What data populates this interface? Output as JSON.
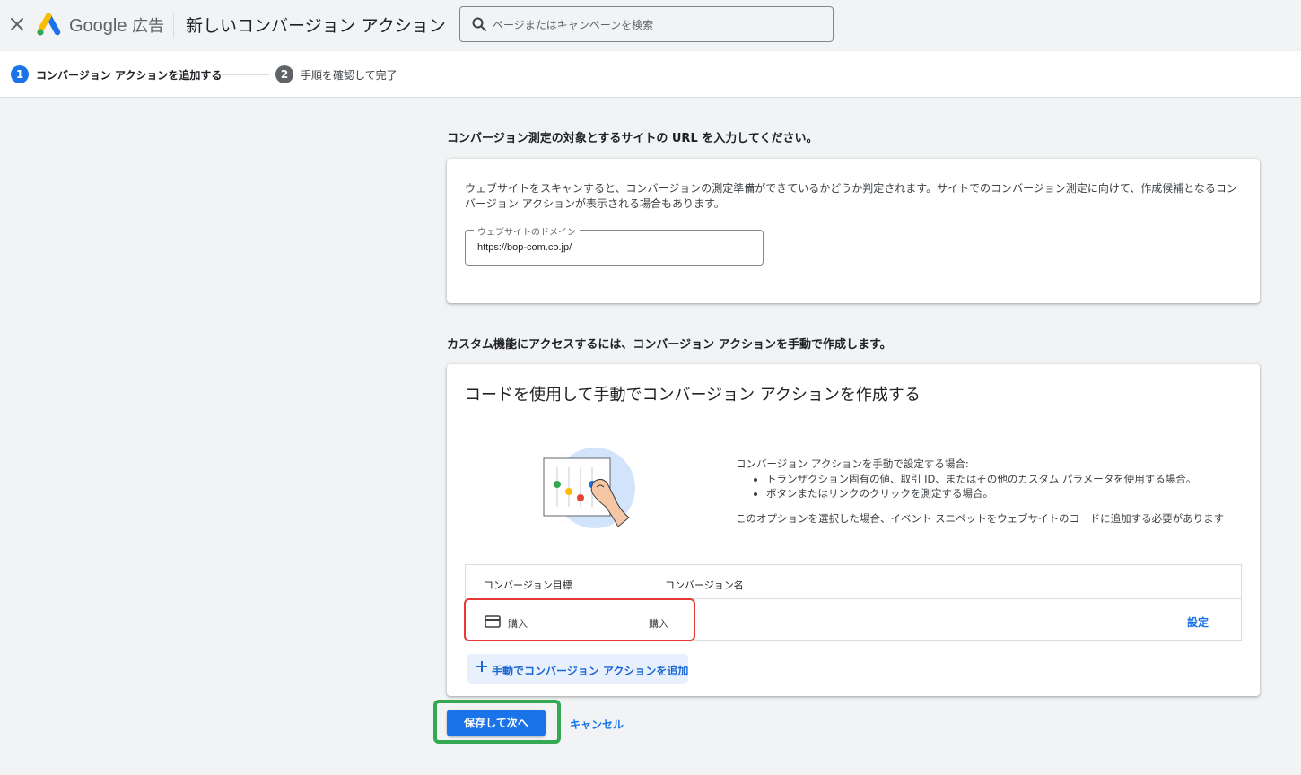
{
  "header": {
    "brand_google": "Google",
    "brand_suffix": "広告",
    "page_title": "新しいコンバージョン アクション",
    "search_placeholder": "ページまたはキャンペーンを検索"
  },
  "stepper": {
    "steps": [
      {
        "number": "1",
        "label": "コンバージョン アクションを追加する"
      },
      {
        "number": "2",
        "label": "手順を確認して完了"
      }
    ]
  },
  "website_section": {
    "heading": "コンバージョン測定の対象とするサイトの URL を入力してください。",
    "description": "ウェブサイトをスキャンすると、コンバージョンの測定準備ができているかどうか判定されます。サイトでのコンバージョン測定に向けて、作成候補となるコンバージョン アクションが表示される場合もあります。",
    "domain_label": "ウェブサイトのドメイン",
    "domain_value": "https://bop-com.co.jp/"
  },
  "manual_section": {
    "heading": "カスタム機能にアクセスするには、コンバージョン アクションを手動で作成します。",
    "card_title": "コードを使用して手動でコンバージョン アクションを作成する",
    "intro": "コンバージョン アクションを手動で設定する場合:",
    "bullets": [
      "トランザクション固有の値、取引 ID、またはその他のカスタム パラメータを使用する場合。",
      "ボタンまたはリンクのクリックを測定する場合。"
    ],
    "note": "このオプションを選択した場合、イベント スニペットをウェブサイトのコードに追加する必要があります",
    "table": {
      "headers": [
        "コンバージョン目標",
        "コンバージョン名"
      ],
      "row": {
        "goal": "購入",
        "name": "購入",
        "action": "設定"
      }
    },
    "add_button": "手動でコンバージョン アクションを追加"
  },
  "footer": {
    "save_label": "保存して次へ",
    "cancel_label": "キャンセル"
  },
  "colors": {
    "primary": "#1a73e8",
    "highlight_red": "#e53935",
    "highlight_green": "#34a853"
  }
}
